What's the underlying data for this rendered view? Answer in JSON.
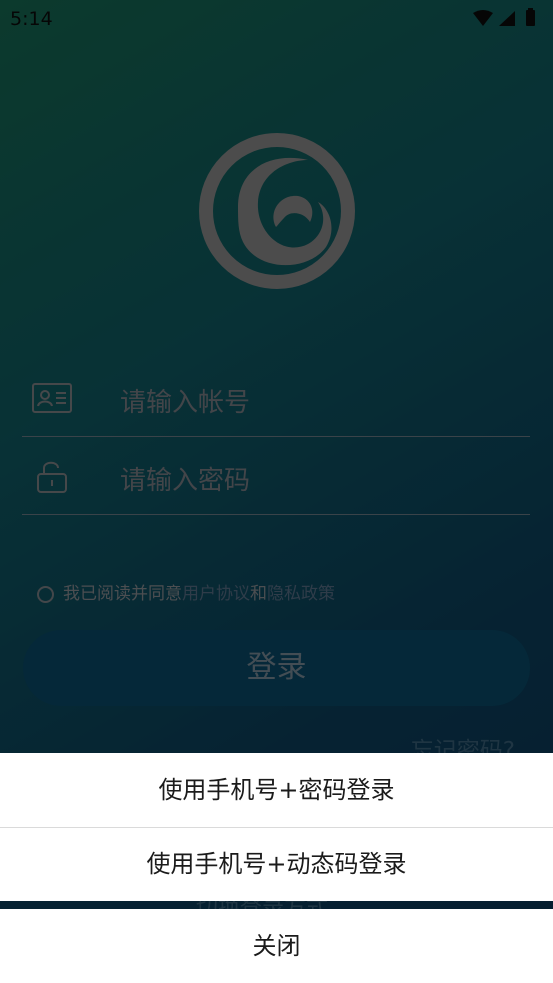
{
  "status": {
    "time": "5:14"
  },
  "form": {
    "account_placeholder": "请输入帐号",
    "password_placeholder": "请输入密码",
    "agreement": {
      "prefix": "我已阅读并同意",
      "terms": "用户协议",
      "and": "和",
      "privacy": "隐私政策"
    },
    "login_button": "登录",
    "forgot_password": "忘记密码?",
    "switch_mode": "切换登录方式"
  },
  "sheet": {
    "option_password": "使用手机号+密码登录",
    "option_code": "使用手机号+动态码登录",
    "close": "关闭"
  },
  "colors": {
    "background_top": "#166a52",
    "background_bottom": "#0a3556",
    "button": "#0a4a68",
    "sheet": "#ffffff"
  }
}
